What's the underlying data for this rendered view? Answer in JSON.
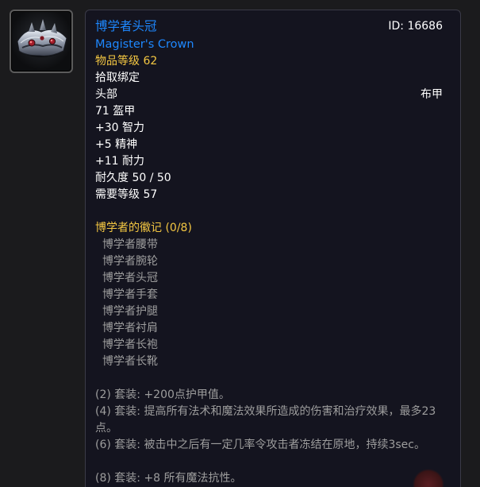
{
  "item": {
    "name_cn": "博学者头冠",
    "name_en": "Magister's Crown",
    "id_text": "ID: 16686",
    "item_level": "物品等级 62",
    "bind": "拾取绑定",
    "slot": "头部",
    "armor_type": "布甲",
    "armor": "71 盔甲",
    "stats": [
      "+30 智力",
      "+5 精神",
      "+11 耐力"
    ],
    "durability": "耐久度 50 / 50",
    "required_level": "需要等级 57"
  },
  "set": {
    "title": "博学者的徽记 (0/8)",
    "pieces": [
      "博学者腰带",
      "博学者腕轮",
      "博学者头冠",
      "博学者手套",
      "博学者护腿",
      "博学者衬肩",
      "博学者长袍",
      "博学者长靴"
    ],
    "bonuses": [
      "(2) 套装: +200点护甲值。",
      "(4) 套装: 提高所有法术和魔法效果所造成的伤害和治疗效果，最多23点。",
      "(6) 套装: 被击中之后有一定几率令攻击者冻结在原地，持续3sec。",
      "(8) 套装: +8 所有魔法抗性。"
    ]
  },
  "colors": {
    "epic_blue": "#1e88ff",
    "set_yellow": "#f4c742",
    "inactive_gray": "#9d9d9d",
    "tooltip_bg": "#14141f"
  },
  "icons": {
    "item_icon": "crown-icon"
  }
}
